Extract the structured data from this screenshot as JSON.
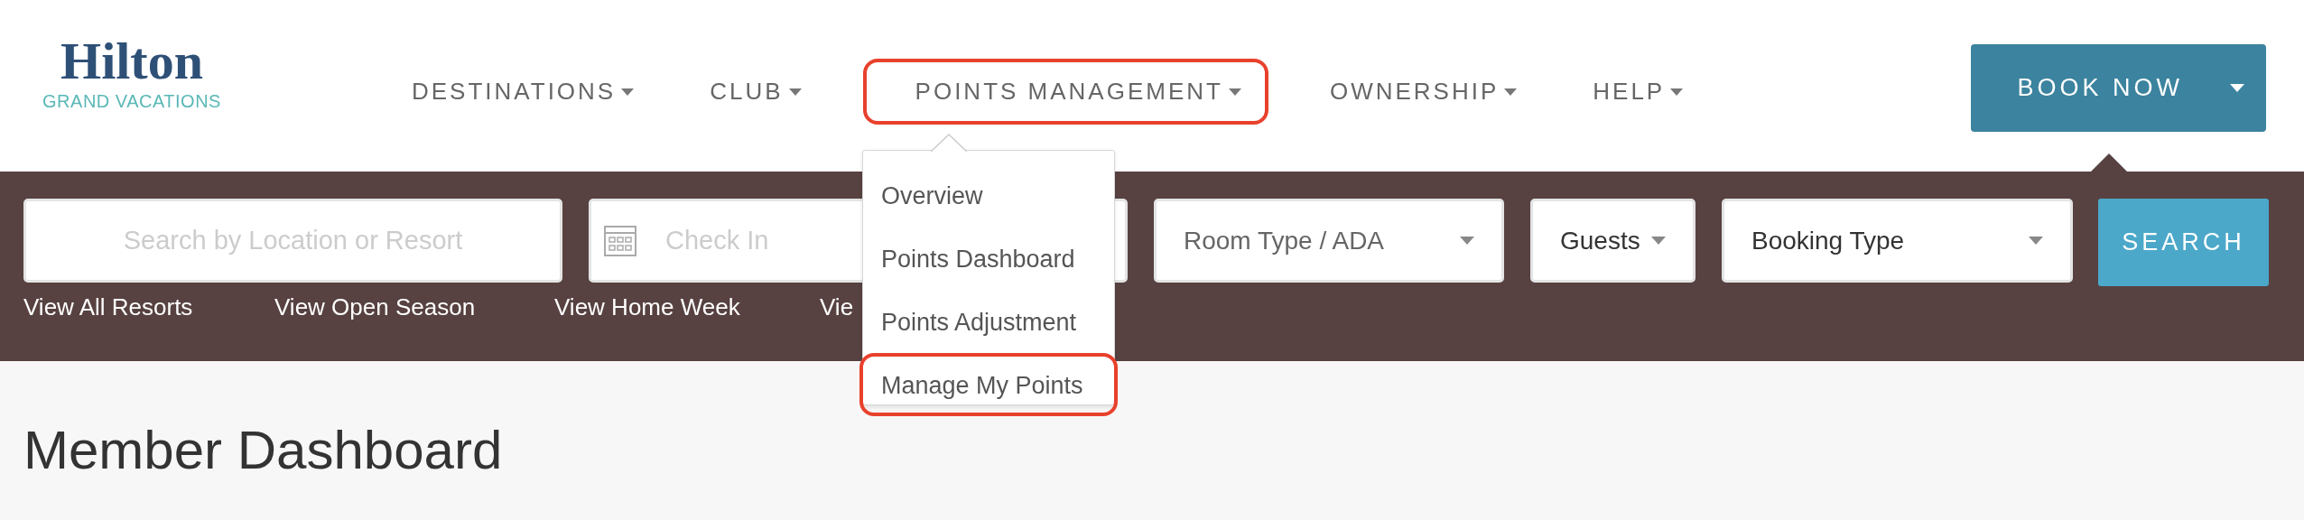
{
  "logo": {
    "name": "Hilton",
    "tagline": "GRAND VACATIONS"
  },
  "nav": [
    {
      "label": "DESTINATIONS",
      "highlighted": false
    },
    {
      "label": "CLUB",
      "highlighted": false
    },
    {
      "label": "POINTS MANAGEMENT",
      "highlighted": true
    },
    {
      "label": "OWNERSHIP",
      "highlighted": false
    },
    {
      "label": "HELP",
      "highlighted": false
    }
  ],
  "book_button": {
    "label": "BOOK NOW"
  },
  "search": {
    "fields": [
      {
        "kind": "text",
        "placeholder": "Search by Location or Resort"
      },
      {
        "kind": "date",
        "placeholder": "Check In"
      },
      {
        "kind": "select",
        "placeholder": "Room Type / ADA"
      },
      {
        "kind": "select",
        "value": "Guests"
      },
      {
        "kind": "select",
        "value": "Booking Type"
      }
    ],
    "button": "SEARCH",
    "links": [
      "View All Resorts",
      "View Open Season",
      "View Home Week",
      "Vie"
    ]
  },
  "dropdown": [
    {
      "label": "Overview",
      "highlighted": false
    },
    {
      "label": "Points Dashboard",
      "highlighted": false
    },
    {
      "label": "Points Adjustment",
      "highlighted": false
    },
    {
      "label": "Manage My Points",
      "highlighted": true
    }
  ],
  "page_title": "Member Dashboard"
}
